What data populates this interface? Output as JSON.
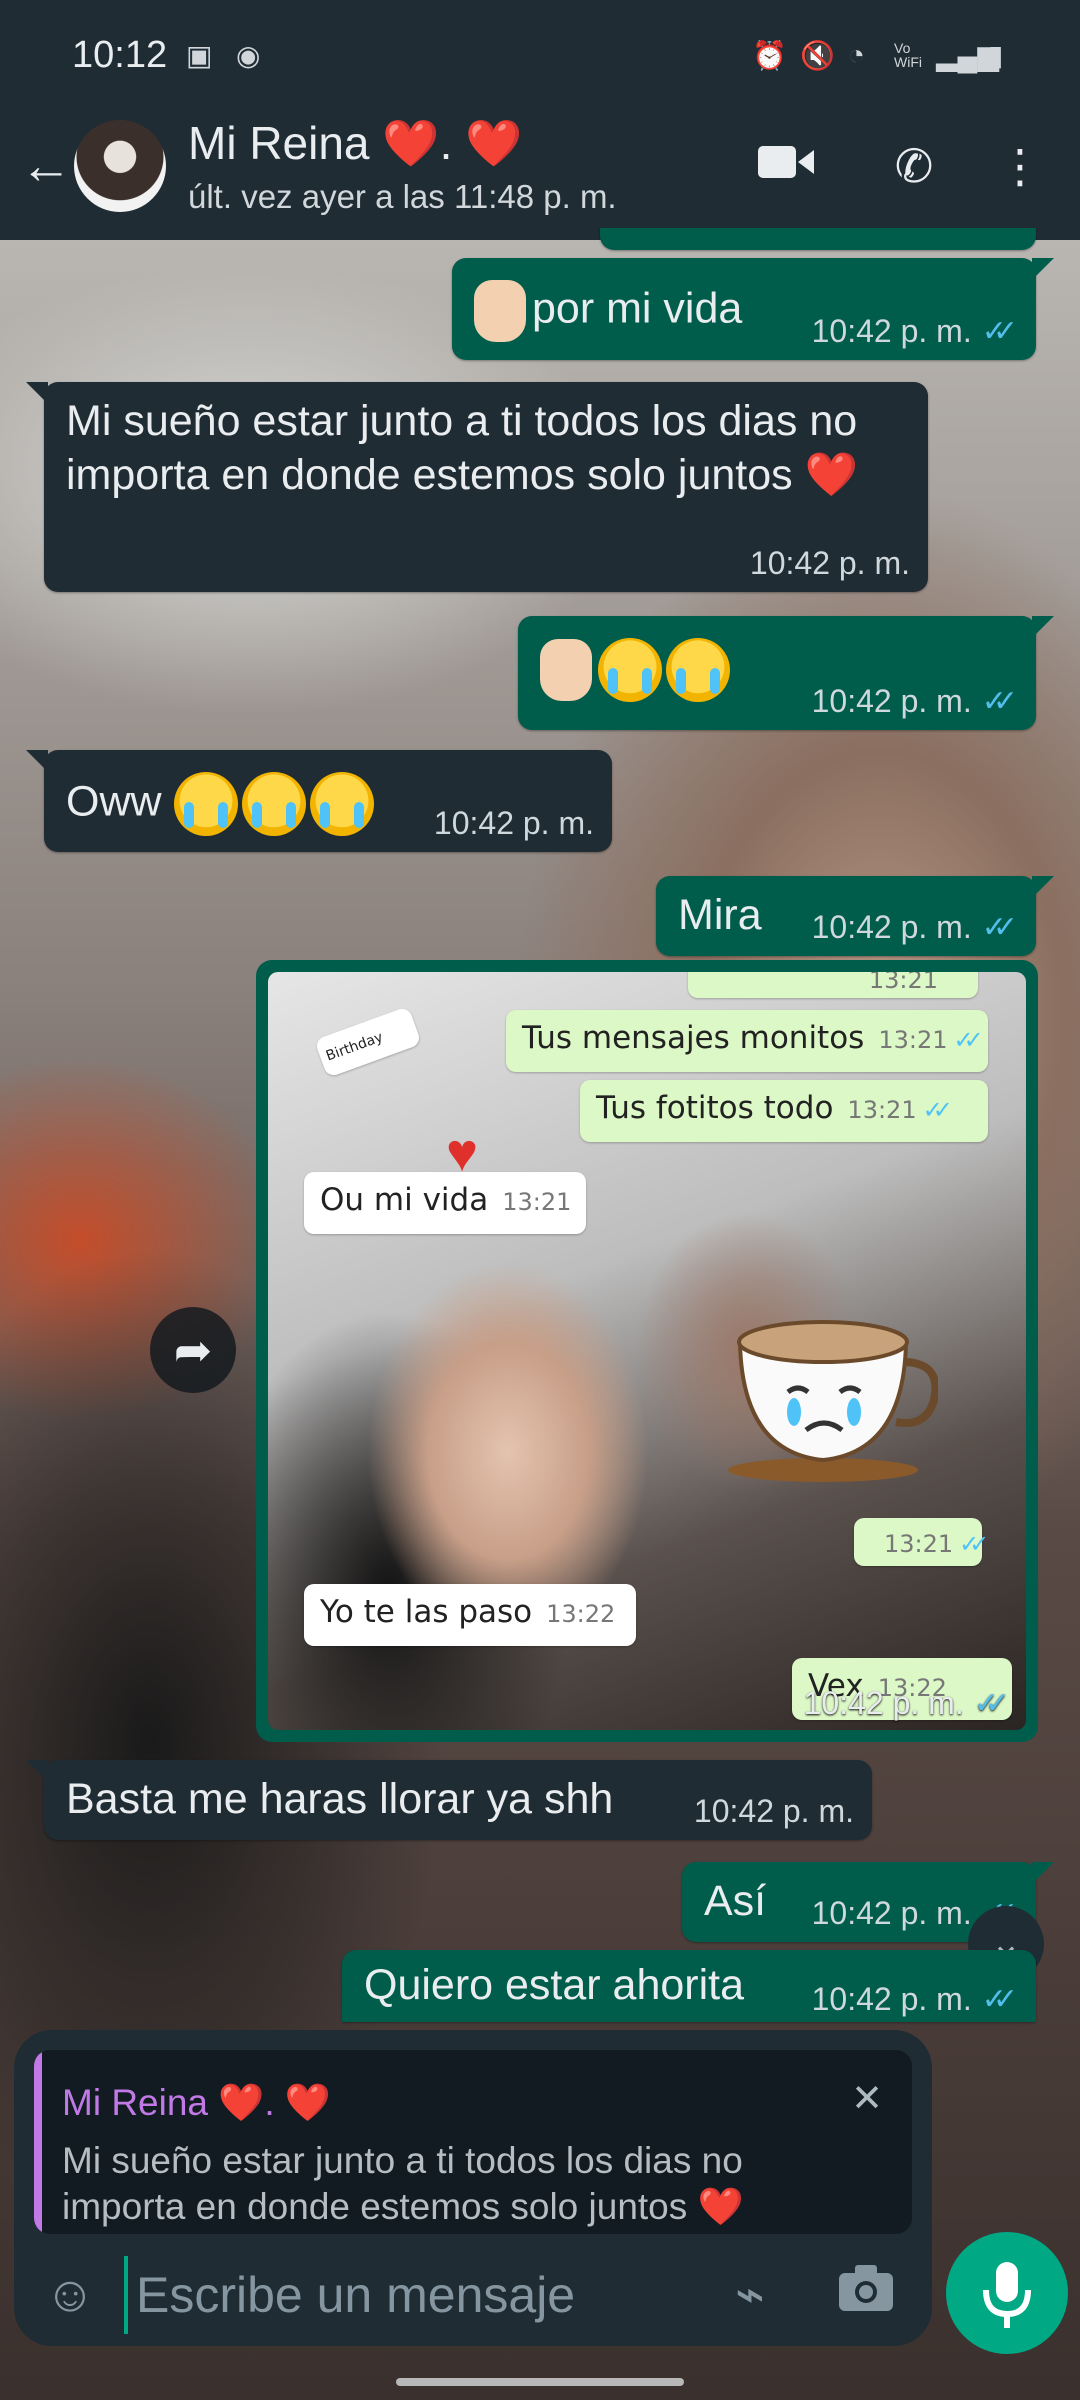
{
  "status_bar": {
    "time": "10:12",
    "vowifi": "Vo WiFi"
  },
  "header": {
    "contact_name": "Mi Reina ❤️. ❤️",
    "last_seen": "últ. vez ayer a las 11:48 p. m."
  },
  "messages": [
    {
      "dir": "out",
      "text": "por mi vida",
      "time": "10:42 p. m.",
      "read": true
    },
    {
      "dir": "in",
      "text": "Mi sueño estar junto a ti todos los dias no importa en donde estemos solo juntos ❤️",
      "time": "10:42 p. m."
    },
    {
      "dir": "out",
      "text": "",
      "time": "10:42 p. m.",
      "read": true
    },
    {
      "dir": "in",
      "text": "Oww",
      "time": "10:42 p. m."
    },
    {
      "dir": "out",
      "text": "Mira",
      "time": "10:42 p. m.",
      "read": true
    },
    {
      "dir": "out",
      "type": "image",
      "time": "10:42 p. m.",
      "read": true
    },
    {
      "dir": "in",
      "text": "Basta me haras llorar ya shh",
      "time": "10:42 p. m."
    },
    {
      "dir": "out",
      "text": "Así",
      "time": "10:42 p. m.",
      "read": true
    },
    {
      "dir": "out",
      "text": "Quiero estar ahorita",
      "time": "10:42 p. m.",
      "read": true
    }
  ],
  "image_content": {
    "sticker_text": "Birthday",
    "bubbles": [
      {
        "dir": "out",
        "text": "Tus mensajes monitos",
        "time": "13:21"
      },
      {
        "dir": "out",
        "text": "Tus fotitos todo",
        "time": "13:21"
      },
      {
        "dir": "in",
        "text": "Ou mi vida",
        "time": "13:21"
      },
      {
        "dir": "out",
        "text": "",
        "time": "13:21"
      },
      {
        "dir": "in",
        "text": "Yo te las paso",
        "time": "13:22"
      },
      {
        "dir": "out",
        "text": "Vex",
        "time": "13:22"
      }
    ]
  },
  "reply_preview": {
    "name": "Mi Reina ❤️. ❤️",
    "text": "Mi sueño estar junto a ti todos los dias no importa en donde estemos solo juntos ❤️"
  },
  "composer": {
    "placeholder": "Escribe un mensaje"
  },
  "colors": {
    "outgoing": "#005c4b",
    "incoming": "#202c33",
    "accent": "#00a884",
    "reply_name": "#c179e5",
    "read_ticks": "#53bdeb"
  }
}
